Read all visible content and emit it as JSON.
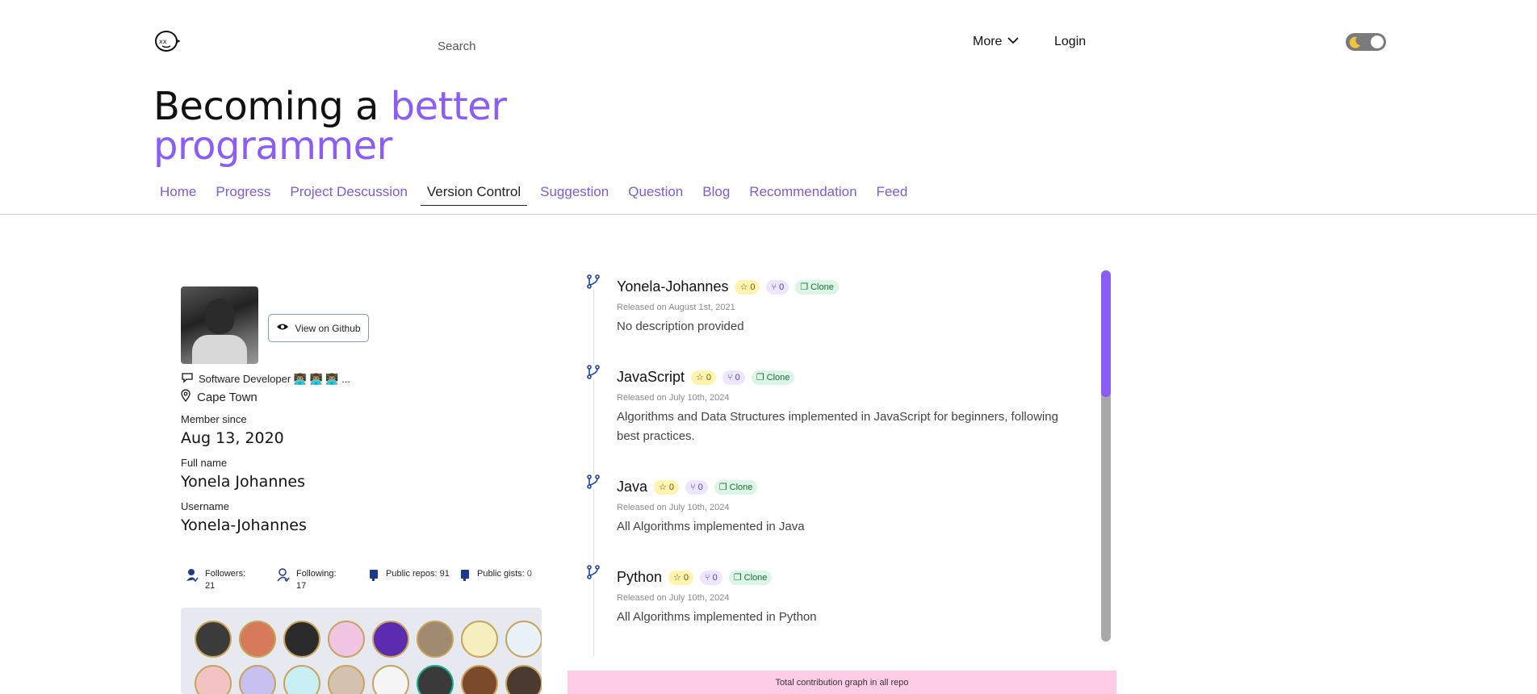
{
  "header": {
    "search_placeholder": "Search",
    "more_label": "More",
    "login_label": "Login"
  },
  "hero": {
    "line1_plain": "Becoming a ",
    "line1_accent": "better",
    "line2_accent": "programmer"
  },
  "nav": {
    "items": [
      {
        "label": "Home"
      },
      {
        "label": "Progress"
      },
      {
        "label": "Project Descussion"
      },
      {
        "label": "Version Control",
        "active": true
      },
      {
        "label": "Suggestion"
      },
      {
        "label": "Question"
      },
      {
        "label": "Blog"
      },
      {
        "label": "Recommendation"
      },
      {
        "label": "Feed"
      }
    ]
  },
  "profile": {
    "view_github_label": "View on Github",
    "bio": "Software Developer 👨🏽‍💻 👨🏽‍💻 👨🏽‍💻 ...",
    "location": "Cape Town",
    "member_since_label": "Member since",
    "member_since": "Aug 13, 2020",
    "full_name_label": "Full name",
    "full_name": "Yonela Johannes",
    "username_label": "Username",
    "username": "Yonela-Johannes",
    "stats": [
      {
        "label": "Followers:",
        "value": "21"
      },
      {
        "label": "Following:",
        "value": "17"
      },
      {
        "label": "Public repos:",
        "value": "91"
      },
      {
        "label": "Public gists:",
        "value": "0"
      }
    ]
  },
  "repos": [
    {
      "name": "Yonela-Johannes",
      "stars": "0",
      "forks": "0",
      "clone_label": "Clone",
      "date": "Released on August 1st, 2021",
      "description": "No description provided"
    },
    {
      "name": "JavaScript",
      "stars": "0",
      "forks": "0",
      "clone_label": "Clone",
      "date": "Released on July 10th, 2024",
      "description": "Algorithms and Data Structures implemented in JavaScript for beginners, following best practices."
    },
    {
      "name": "Java",
      "stars": "0",
      "forks": "0",
      "clone_label": "Clone",
      "date": "Released on July 10th, 2024",
      "description": "All Algorithms implemented in Java"
    },
    {
      "name": "Python",
      "stars": "0",
      "forks": "0",
      "clone_label": "Clone",
      "date": "Released on July 10th, 2024",
      "description": "All Algorithms implemented in Python"
    }
  ],
  "contribution_label": "Total contribution graph in all repo",
  "colors": {
    "accent": "#8b5cf6",
    "nav_link": "#7c5ad8",
    "contribution_bg": "#ffcce8"
  },
  "icons": {
    "logo": "skull-logo-icon",
    "more": "chevron-down-icon",
    "theme": "moon-icon",
    "github": "eye-icon",
    "bio": "chat-icon",
    "location": "map-pin-icon",
    "repo": "git-branch-icon",
    "star": "star-icon",
    "fork": "fork-icon",
    "clone": "copy-icon"
  }
}
